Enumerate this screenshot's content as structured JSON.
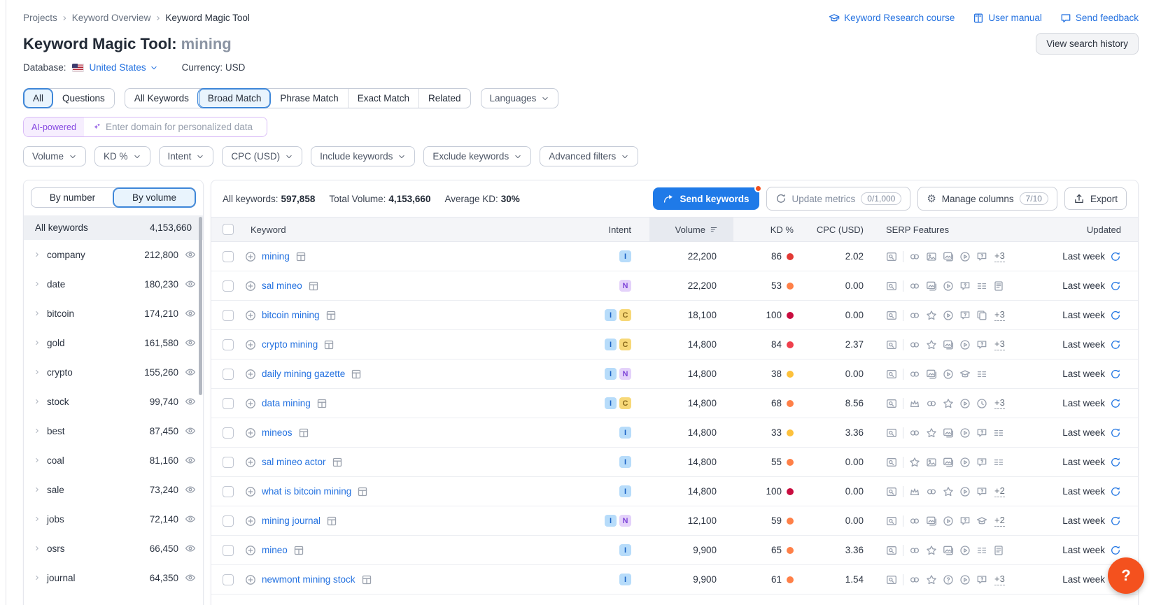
{
  "breadcrumb": {
    "items": [
      "Projects",
      "Keyword Overview",
      "Keyword Magic Tool"
    ]
  },
  "header": {
    "links": [
      {
        "label": "Keyword Research course",
        "icon": "graduation-cap"
      },
      {
        "label": "User manual",
        "icon": "book"
      },
      {
        "label": "Send feedback",
        "icon": "speech-bubble"
      }
    ],
    "view_search_history": "View search history",
    "title": "Keyword Magic Tool:",
    "title_query": "mining",
    "database_label": "Database:",
    "database_value": "United States",
    "currency_label": "Currency:",
    "currency_value": "USD"
  },
  "tabs": {
    "group1": [
      {
        "label": "All",
        "active": true
      },
      {
        "label": "Questions",
        "active": false
      }
    ],
    "group2": [
      {
        "label": "All Keywords",
        "active": false
      },
      {
        "label": "Broad Match",
        "active": true
      },
      {
        "label": "Phrase Match",
        "active": false
      },
      {
        "label": "Exact Match",
        "active": false
      },
      {
        "label": "Related",
        "active": false
      }
    ],
    "languages": "Languages"
  },
  "ai_bar": {
    "badge": "AI-powered",
    "placeholder": "Enter domain for personalized data"
  },
  "filters": [
    "Volume",
    "KD %",
    "Intent",
    "CPC (USD)",
    "Include keywords",
    "Exclude keywords",
    "Advanced filters"
  ],
  "sidebar": {
    "toggle": [
      {
        "label": "By number",
        "active": false
      },
      {
        "label": "By volume",
        "active": true
      }
    ],
    "all_row": {
      "label": "All keywords",
      "value": "4,153,660"
    },
    "groups": [
      {
        "name": "company",
        "value": "212,800"
      },
      {
        "name": "date",
        "value": "180,230"
      },
      {
        "name": "bitcoin",
        "value": "174,210"
      },
      {
        "name": "gold",
        "value": "161,580"
      },
      {
        "name": "crypto",
        "value": "155,260"
      },
      {
        "name": "stock",
        "value": "99,740"
      },
      {
        "name": "best",
        "value": "87,450"
      },
      {
        "name": "coal",
        "value": "81,160"
      },
      {
        "name": "sale",
        "value": "73,240"
      },
      {
        "name": "jobs",
        "value": "72,140"
      },
      {
        "name": "osrs",
        "value": "66,450"
      },
      {
        "name": "journal",
        "value": "64,350"
      }
    ]
  },
  "toolbar": {
    "stats": [
      {
        "label": "All keywords:",
        "value": "597,858"
      },
      {
        "label": "Total Volume:",
        "value": "4,153,660"
      },
      {
        "label": "Average KD:",
        "value": "30%"
      }
    ],
    "send_keywords": "Send keywords",
    "update_metrics": "Update metrics",
    "update_metrics_count": "0/1,000",
    "manage_columns": "Manage columns",
    "manage_columns_count": "7/10",
    "export": "Export"
  },
  "table": {
    "columns": [
      "Keyword",
      "Intent",
      "Volume",
      "KD %",
      "CPC (USD)",
      "SERP Features",
      "Updated"
    ],
    "rows": [
      {
        "keyword": "mining",
        "intents": [
          "I"
        ],
        "volume": "22,200",
        "kd": "86",
        "kd_color": "#e23a35",
        "cpc": "2.02",
        "serp": [
          "link",
          "image",
          "image-stack",
          "video",
          "qa"
        ],
        "more": "+3",
        "updated": "Last week"
      },
      {
        "keyword": "sal mineo",
        "intents": [
          "N"
        ],
        "volume": "22,200",
        "kd": "53",
        "kd_color": "#ff8048",
        "cpc": "0.00",
        "serp": [
          "link",
          "image-stack",
          "video",
          "qa",
          "list",
          "article"
        ],
        "more": null,
        "updated": "Last week"
      },
      {
        "keyword": "bitcoin mining",
        "intents": [
          "I",
          "C"
        ],
        "volume": "18,100",
        "kd": "100",
        "kd_color": "#c90c3f",
        "cpc": "0.00",
        "serp": [
          "link",
          "star",
          "video",
          "qa",
          "copy"
        ],
        "more": "+3",
        "updated": "Last week"
      },
      {
        "keyword": "crypto mining",
        "intents": [
          "I",
          "C"
        ],
        "volume": "14,800",
        "kd": "84",
        "kd_color": "#ef404d",
        "cpc": "2.37",
        "serp": [
          "link",
          "star",
          "image-stack",
          "video",
          "qa"
        ],
        "more": "+3",
        "updated": "Last week"
      },
      {
        "keyword": "daily mining gazette",
        "intents": [
          "I",
          "N"
        ],
        "volume": "14,800",
        "kd": "38",
        "kd_color": "#fdc13c",
        "cpc": "0.00",
        "serp": [
          "link",
          "image-stack",
          "video",
          "education",
          "list"
        ],
        "more": null,
        "updated": "Last week"
      },
      {
        "keyword": "data mining",
        "intents": [
          "I",
          "C"
        ],
        "volume": "14,800",
        "kd": "68",
        "kd_color": "#ff8048",
        "cpc": "8.56",
        "serp": [
          "crown",
          "link",
          "star",
          "video",
          "history"
        ],
        "more": "+3",
        "updated": "Last week"
      },
      {
        "keyword": "mineos",
        "intents": [
          "I"
        ],
        "volume": "14,800",
        "kd": "33",
        "kd_color": "#fdc13c",
        "cpc": "3.36",
        "serp": [
          "link",
          "star",
          "image-stack",
          "video",
          "qa",
          "list"
        ],
        "more": null,
        "updated": "Last week"
      },
      {
        "keyword": "sal mineo actor",
        "intents": [
          "I"
        ],
        "volume": "14,800",
        "kd": "55",
        "kd_color": "#ff8048",
        "cpc": "0.00",
        "serp": [
          "star",
          "image",
          "image-stack",
          "video",
          "qa",
          "list"
        ],
        "more": null,
        "updated": "Last week"
      },
      {
        "keyword": "what is bitcoin mining",
        "intents": [
          "I"
        ],
        "volume": "14,800",
        "kd": "100",
        "kd_color": "#c90c3f",
        "cpc": "0.00",
        "serp": [
          "crown",
          "link",
          "star",
          "video",
          "qa"
        ],
        "more": "+2",
        "updated": "Last week"
      },
      {
        "keyword": "mining journal",
        "intents": [
          "I",
          "N"
        ],
        "volume": "12,100",
        "kd": "59",
        "kd_color": "#ff8048",
        "cpc": "0.00",
        "serp": [
          "link",
          "image-stack",
          "video",
          "qa",
          "education"
        ],
        "more": "+2",
        "updated": "Last week"
      },
      {
        "keyword": "mineo",
        "intents": [
          "I"
        ],
        "volume": "9,900",
        "kd": "65",
        "kd_color": "#ff8048",
        "cpc": "3.36",
        "serp": [
          "link",
          "star",
          "image-stack",
          "video",
          "list",
          "article"
        ],
        "more": null,
        "updated": "Last week"
      },
      {
        "keyword": "newmont mining stock",
        "intents": [
          "I"
        ],
        "volume": "9,900",
        "kd": "61",
        "kd_color": "#ff8048",
        "cpc": "1.54",
        "serp": [
          "link",
          "star",
          "question",
          "video",
          "qa"
        ],
        "more": "+3",
        "updated": "Last week"
      }
    ]
  },
  "intent_colors": {
    "I": {
      "bg": "#b7dcfa",
      "fg": "#1a62c5"
    },
    "N": {
      "bg": "#e4d2fa",
      "fg": "#7f46d8"
    },
    "C": {
      "bg": "#f7d878",
      "fg": "#8a6a1c"
    }
  },
  "colors": {
    "accent_blue": "#1f7ae8",
    "link_blue": "#2371e0",
    "ai_purple": "#8649e1",
    "help_orange": "#f4511e"
  },
  "help": {
    "label": "?"
  }
}
